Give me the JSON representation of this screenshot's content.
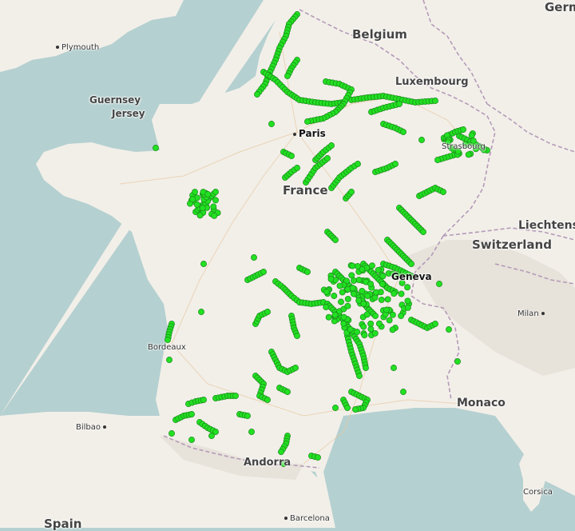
{
  "map": {
    "labels": {
      "germany": "Germ",
      "belgium": "Belgium",
      "luxembourg": "Luxembourg",
      "plymouth": "Plymouth",
      "guernsey": "Guernsey",
      "jersey": "Jersey",
      "paris": "Paris",
      "strasbourg": "Strasbourg",
      "france": "France",
      "liechtenstein": "Liechtenst",
      "switzerland": "Switzerland",
      "geneva": "Geneva",
      "milan": "Milan",
      "bordeaux": "Bordeaux",
      "monaco": "Monaco",
      "bilbao": "Bilbao",
      "andorra": "Andorra",
      "corsica": "Corsica",
      "spain": "Spain",
      "barcelona": "Barcelona"
    },
    "colors": {
      "sea": "#b5d0d0",
      "land": "#f2efe9",
      "marker": "#22e022",
      "marker_outline": "#1a8a1a",
      "border": "#b49bb8"
    }
  }
}
